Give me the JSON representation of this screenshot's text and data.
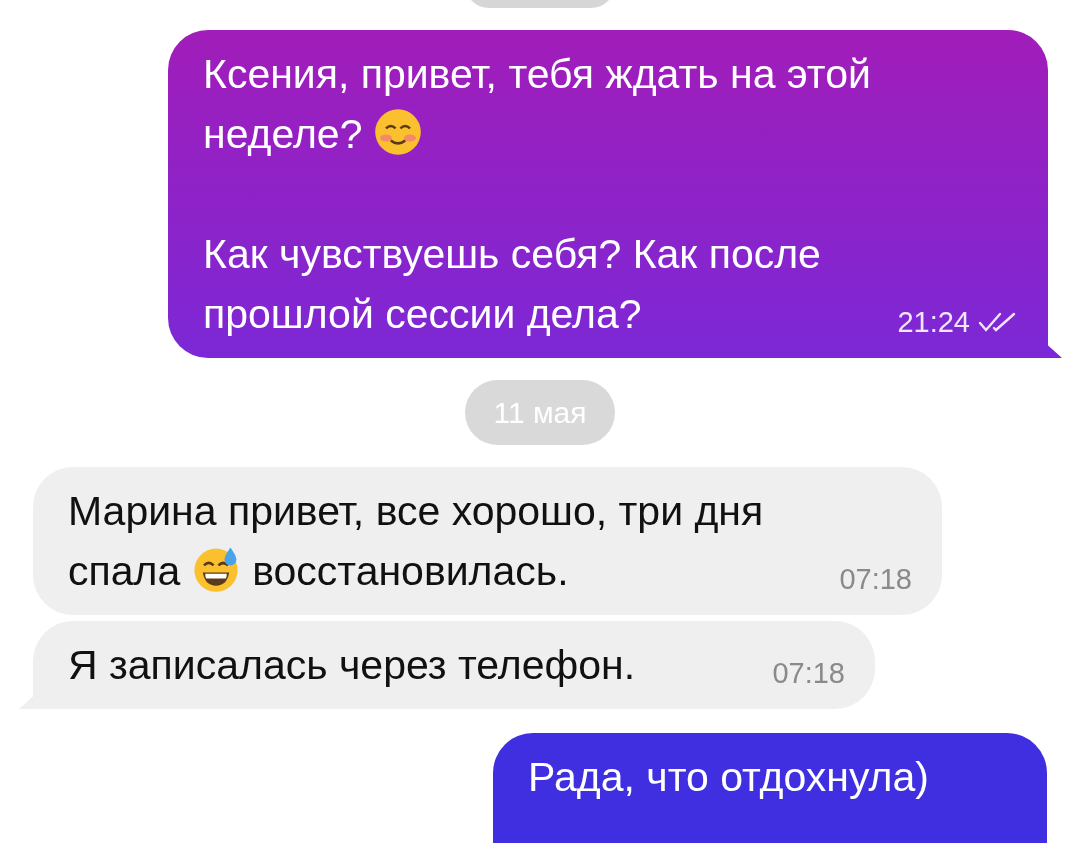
{
  "messages": [
    {
      "kind": "outgoing",
      "tail": true,
      "paragraphs": [
        [
          {
            "kind": "text",
            "text": "Ксения, привет, тебя ждать на этой неделе?"
          },
          {
            "kind": "smile"
          }
        ],
        [
          {
            "kind": "text",
            "text": "Как чувствуешь себя? Как после прошлой сессии дела?"
          }
        ]
      ],
      "time": "21:24",
      "read": true
    },
    {
      "kind": "date",
      "text": "11 мая"
    },
    {
      "kind": "incoming",
      "tail": false,
      "paragraphs": [
        [
          {
            "kind": "text",
            "text": "Марина привет, все хорошо, три дня"
          },
          {
            "kind": "break"
          },
          {
            "kind": "text",
            "text": "спала"
          },
          {
            "kind": "sweat"
          },
          {
            "kind": "text",
            "text": "восстановилась."
          }
        ]
      ],
      "time": "07:18"
    },
    {
      "kind": "incoming",
      "tail": true,
      "paragraphs": [
        [
          {
            "kind": "text",
            "text": "Я записалась через телефон."
          }
        ]
      ],
      "time": "07:18"
    },
    {
      "kind": "outgoing",
      "tail": false,
      "paragraphs": [
        [
          {
            "kind": "text",
            "text": "Рада, что отдохнула)"
          }
        ]
      ]
    }
  ]
}
